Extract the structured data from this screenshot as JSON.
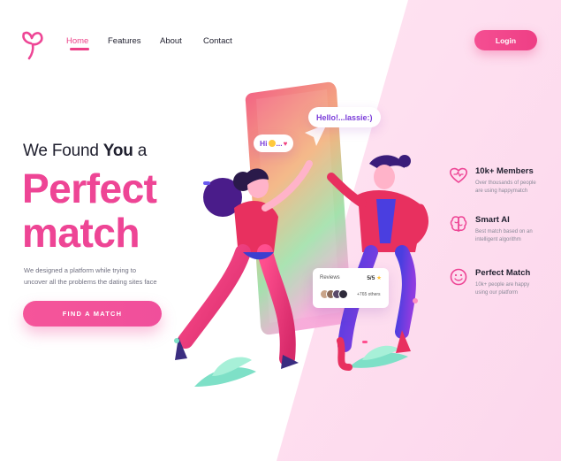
{
  "nav": {
    "items": [
      {
        "label": "Home",
        "active": true
      },
      {
        "label": "Features",
        "active": false
      },
      {
        "label": "About",
        "active": false
      },
      {
        "label": "Contact",
        "active": false
      }
    ],
    "login_label": "Login"
  },
  "hero": {
    "subtitle_prefix": "We Found ",
    "subtitle_bold": "You",
    "subtitle_suffix": " a",
    "headline_line1": "Perfect",
    "headline_line2": "match",
    "description_line1": "We designed a platform while trying to",
    "description_line2": "uncover all the problems the dating sites face",
    "cta_label": "FIND A MATCH"
  },
  "illustration": {
    "bubble_hello": "Hello!...lassie:)",
    "bubble_hi": "Hi",
    "bubble_hi_dots": "...",
    "reviews": {
      "label": "Reviews",
      "score": "5/5",
      "others": "+765 others"
    }
  },
  "features": [
    {
      "icon": "heart-outline-icon",
      "title": "10k+ Members",
      "desc_line1": "Over thousands of people",
      "desc_line2": "are using happymatch"
    },
    {
      "icon": "brain-icon",
      "title": "Smart AI",
      "desc_line1": "Best match based on an",
      "desc_line2": "intelligent algorithm"
    },
    {
      "icon": "smiley-icon",
      "title": "Perfect Match",
      "desc_line1": "10k+ people are happy",
      "desc_line2": "using our platform"
    }
  ],
  "colors": {
    "accent": "#ee4595",
    "panel_bg": "#fde4f2",
    "nav_text": "#1f1f2e",
    "brand_purple": "#7a3cd9"
  }
}
